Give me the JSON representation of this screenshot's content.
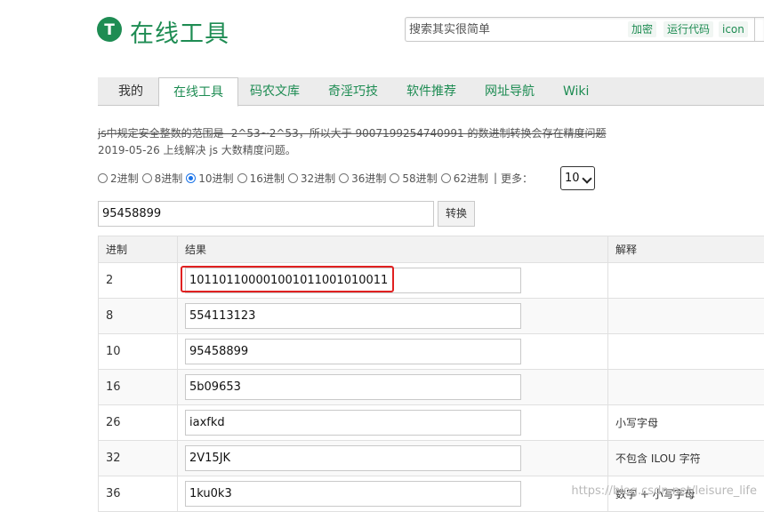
{
  "header": {
    "logo_letter": "T",
    "site_title": "在线工具",
    "search_placeholder": "搜索其实很简单",
    "search_chips": [
      "加密",
      "运行代码",
      "icon"
    ]
  },
  "tabs": [
    "我的",
    "在线工具",
    "码农文库",
    "奇淫巧技",
    "软件推荐",
    "网址导航",
    "Wiki"
  ],
  "notes": {
    "line1": "js中规定安全整数的范围是 -2^53~2^53，所以大于 9007199254740991 的数进制转换会存在精度问题",
    "line2": "2019-05-26 上线解决 js 大数精度问题。"
  },
  "radix_options": [
    "2进制",
    "8进制",
    "10进制",
    "16进制",
    "32进制",
    "36进制",
    "58进制",
    "62进制"
  ],
  "selected_radix": "10进制",
  "more_label": "更多：",
  "more_select_value": "10",
  "input_value": "95458899",
  "convert_label": "转换",
  "table": {
    "headers": [
      "进制",
      "结果",
      "解释"
    ],
    "rows": [
      {
        "base": "2",
        "result": "101101100001001011001010011",
        "note": ""
      },
      {
        "base": "8",
        "result": "554113123",
        "note": ""
      },
      {
        "base": "10",
        "result": "95458899",
        "note": ""
      },
      {
        "base": "16",
        "result": "5b09653",
        "note": ""
      },
      {
        "base": "26",
        "result": "iaxfkd",
        "note": "小写字母"
      },
      {
        "base": "32",
        "result": "2V15JK",
        "note": "不包含 ILOU 字符"
      },
      {
        "base": "36",
        "result": "1ku0k3",
        "note": "数字 + 小写字母"
      }
    ]
  },
  "watermark": "https://blog.csdn.net/leisure_life",
  "colors": {
    "brand_green": "#1e8c53",
    "highlight_red": "#e02020",
    "radio_blue": "#1a73e8"
  }
}
